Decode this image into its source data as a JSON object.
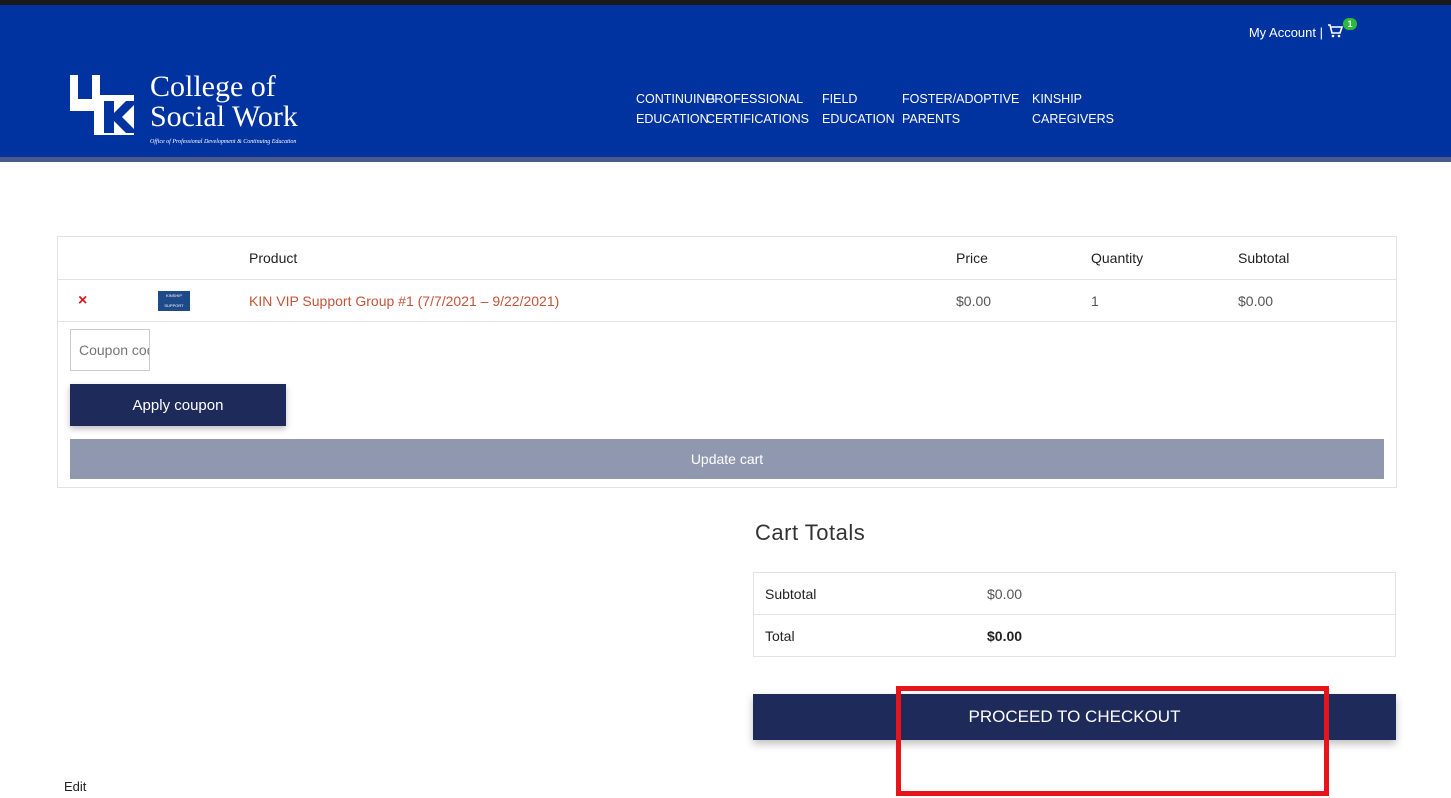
{
  "header": {
    "account_label": "My Account |",
    "cart_count": "1",
    "logo_line1": "College of",
    "logo_line2": "Social Work",
    "logo_tagline": "Office of Professional Development & Continuing Education",
    "nav": [
      {
        "line1": "CONTINUING",
        "line2": "EDUCATION"
      },
      {
        "line1": "PROFESSIONAL",
        "line2": "CERTIFICATIONS"
      },
      {
        "line1": "FIELD",
        "line2": "EDUCATION"
      },
      {
        "line1": "FOSTER/ADOPTIVE",
        "line2": "PARENTS"
      },
      {
        "line1": "KINSHIP",
        "line2": "CAREGIVERS"
      }
    ],
    "colors": {
      "header_bg": "#0033a0",
      "badge": "#2bbb3a"
    }
  },
  "cart": {
    "headers": {
      "product": "Product",
      "price": "Price",
      "quantity": "Quantity",
      "subtotal": "Subtotal"
    },
    "items": [
      {
        "remove": "×",
        "thumb_text": "KINSHIP SUPPORT",
        "name": "KIN VIP Support Group #1 (7/7/2021 – 9/22/2021)",
        "price": "$0.00",
        "quantity": "1",
        "subtotal": "$0.00"
      }
    ],
    "coupon_placeholder": "Coupon code",
    "apply_label": "Apply coupon",
    "update_label": "Update cart"
  },
  "totals": {
    "title": "Cart Totals",
    "subtotal_label": "Subtotal",
    "subtotal_value": "$0.00",
    "total_label": "Total",
    "total_value": "$0.00",
    "checkout_label": "PROCEED TO CHECKOUT"
  },
  "footer": {
    "edit_label": "Edit"
  }
}
